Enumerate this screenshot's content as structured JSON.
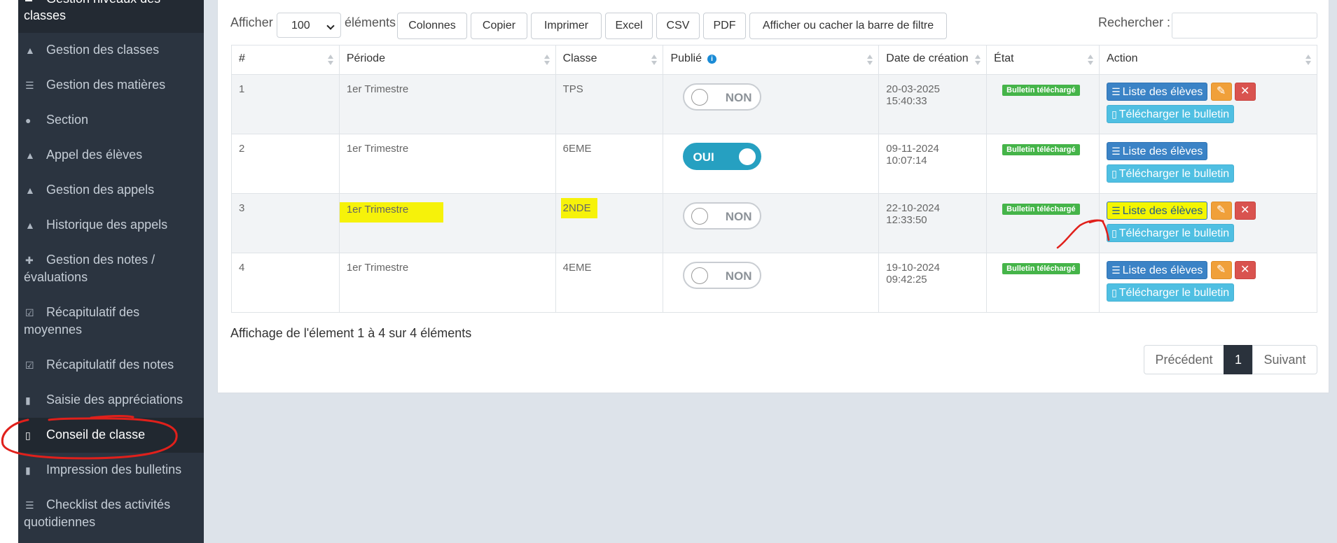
{
  "sidebar": {
    "header": {
      "line1": "Gestion niveaux des",
      "line2": "classes"
    },
    "items": [
      {
        "label": "Gestion des classes",
        "icon": "sitemap-icon"
      },
      {
        "label": "Gestion des matières",
        "icon": "stack-icon"
      },
      {
        "label": "Section",
        "icon": "users-icon"
      },
      {
        "label": "Appel des élèves",
        "icon": "classroom-icon"
      },
      {
        "label": "Gestion des appels",
        "icon": "classroom-icon"
      },
      {
        "label": "Historique des appels",
        "icon": "classroom-icon"
      },
      {
        "label_line1": "Gestion des notes /",
        "label_line2": "évaluations",
        "icon": "puzzle-icon"
      },
      {
        "label_line1": "Récapitulatif des",
        "label_line2": "moyennes",
        "icon": "check-square-icon"
      },
      {
        "label": "Récapitulatif des notes",
        "icon": "check-square-icon"
      },
      {
        "label": "Saisie des appréciations",
        "icon": "file-icon"
      },
      {
        "label": "Conseil de classe",
        "icon": "file-outline-icon",
        "active": true
      },
      {
        "label": "Impression des bulletins",
        "icon": "file-icon"
      },
      {
        "label_line1": "Checklist des activités",
        "label_line2": "quotidiennes",
        "icon": "stack-icon"
      }
    ]
  },
  "toolbar": {
    "show_label": "Afficher",
    "page_size": "100",
    "elements_label": "éléments",
    "buttons": [
      "Colonnes",
      "Copier",
      "Imprimer",
      "Excel",
      "CSV",
      "PDF",
      "Afficher ou cacher la barre de filtre"
    ],
    "search_label": "Rechercher :",
    "search_value": ""
  },
  "table": {
    "columns": [
      "#",
      "Période",
      "Classe",
      "Publié",
      "Date de création",
      "État",
      "Action"
    ],
    "rows": [
      {
        "num": "1",
        "periode": "1er Trimestre",
        "classe": "TPS",
        "publie": "NON",
        "date": "20-03-2025",
        "time": "15:40:33",
        "etat": "Bulletin téléchargé",
        "has_edit": true
      },
      {
        "num": "2",
        "periode": "1er Trimestre",
        "classe": "6EME",
        "publie": "OUI",
        "date": "09-11-2024",
        "time": "10:07:14",
        "etat": "Bulletin téléchargé",
        "has_edit": false
      },
      {
        "num": "3",
        "periode": "1er Trimestre",
        "classe": "2NDE",
        "publie": "NON",
        "date": "22-10-2024",
        "time": "12:33:50",
        "etat": "Bulletin téléchargé",
        "has_edit": true,
        "highlighted": true
      },
      {
        "num": "4",
        "periode": "1er Trimestre",
        "classe": "4EME",
        "publie": "NON",
        "date": "19-10-2024",
        "time": "09:42:25",
        "etat": "Bulletin téléchargé",
        "has_edit": true
      }
    ],
    "action_list_label": "Liste des élèves",
    "action_download_label": "Télécharger le bulletin"
  },
  "footer": {
    "info": "Affichage de l'élement 1 à 4 sur 4 éléments",
    "prev": "Précédent",
    "page": "1",
    "next": "Suivant"
  },
  "colors": {
    "sidebar_bg": "#2b3440",
    "toggle_on": "#26a0c1",
    "badge_green": "#45b449",
    "btn_blue": "#3b83c6",
    "btn_cyan": "#4fbfe2",
    "highlight": "#f6f20a",
    "annotation_red": "#e0201b"
  }
}
